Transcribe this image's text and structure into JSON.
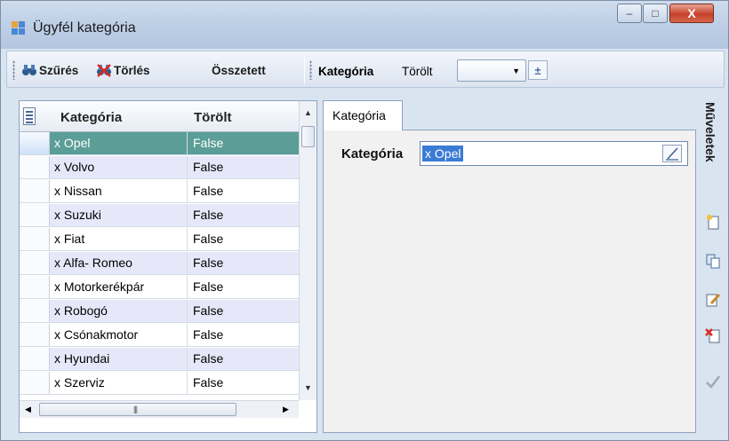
{
  "window": {
    "title": "Ügyfél kategória"
  },
  "toolbar": {
    "filter_label": "Szűrés",
    "delete_label": "Törlés",
    "combined_label": "Összetett",
    "category_label": "Kategória",
    "deleted_label": "Törölt",
    "combo_value": ""
  },
  "grid": {
    "columns": [
      "Kategória",
      "Törölt"
    ],
    "rows": [
      {
        "kategoria": "x Opel",
        "torolt": "False"
      },
      {
        "kategoria": "x Volvo",
        "torolt": "False"
      },
      {
        "kategoria": "x Nissan",
        "torolt": "False"
      },
      {
        "kategoria": "x Suzuki",
        "torolt": "False"
      },
      {
        "kategoria": "x Fiat",
        "torolt": "False"
      },
      {
        "kategoria": "x Alfa- Romeo",
        "torolt": "False"
      },
      {
        "kategoria": "x Motorkerékpár",
        "torolt": "False"
      },
      {
        "kategoria": "x Robogó",
        "torolt": "False"
      },
      {
        "kategoria": "x Csónakmotor",
        "torolt": "False"
      },
      {
        "kategoria": "x Hyundai",
        "torolt": "False"
      },
      {
        "kategoria": "x Szerviz",
        "torolt": "False"
      }
    ],
    "selected_row": 0
  },
  "detail": {
    "tab_label": "Kategória",
    "field_label": "Kategória",
    "field_value": "x Opel"
  },
  "actions": {
    "title": "Műveletek"
  },
  "colors": {
    "selected_row": "#5a9e97",
    "alt_row": "#e6e8fa",
    "text_highlight": "#3a7bd5"
  }
}
